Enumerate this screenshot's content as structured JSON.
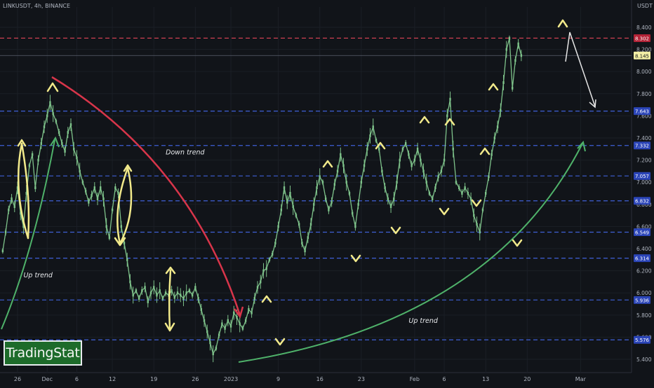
{
  "header": {
    "symbol": "LINKUSDT, 4h, BINANCE",
    "currency": "USDT"
  },
  "watermark": {
    "text": "TradingStat"
  },
  "colors": {
    "background": "#111419",
    "candle": "#7ec28a",
    "level_line": "#3f5fd6",
    "resistance_line": "#e04457",
    "down_trend": "#d8354a",
    "up_trend": "#4fb26a",
    "markers": "#f2ea8b",
    "projection": "#e6e6e6"
  },
  "chart_data": {
    "type": "line",
    "title": "",
    "xlabel": "",
    "ylabel": "",
    "ylim": [
      5.28,
      8.52
    ],
    "y_ticks": [
      5.4,
      5.6,
      5.8,
      6.0,
      6.2,
      6.4,
      6.6,
      6.8,
      7.0,
      7.2,
      7.4,
      7.6,
      7.8,
      8.0,
      8.2,
      8.4
    ],
    "y_tick_labels": [
      "5.400",
      "5.600",
      "5.800",
      "6.000",
      "6.200",
      "6.400",
      "6.600",
      "6.800",
      "7.000",
      "7.200",
      "7.400",
      "7.600",
      "7.800",
      "8.000",
      "8.200",
      "8.400"
    ],
    "x_range": [
      -5,
      96
    ],
    "x_ticks": [
      {
        "day": -5,
        "label": "26"
      },
      {
        "day": 0,
        "label": "Dec"
      },
      {
        "day": 5,
        "label": "6"
      },
      {
        "day": 11,
        "label": "12"
      },
      {
        "day": 18,
        "label": "19"
      },
      {
        "day": 25,
        "label": "26"
      },
      {
        "day": 31,
        "label": "2023"
      },
      {
        "day": 39,
        "label": "9"
      },
      {
        "day": 46,
        "label": "16"
      },
      {
        "day": 53,
        "label": "23"
      },
      {
        "day": 62,
        "label": "Feb"
      },
      {
        "day": 67,
        "label": "6"
      },
      {
        "day": 74,
        "label": "13"
      },
      {
        "day": 81,
        "label": "20"
      },
      {
        "day": 90,
        "label": "Mar"
      }
    ],
    "horizontal_levels": [
      {
        "value": 8.302,
        "label": "8.302",
        "style": "red"
      },
      {
        "value": 7.643,
        "label": "7.643",
        "style": "blue"
      },
      {
        "value": 7.332,
        "label": "7.332",
        "style": "blue"
      },
      {
        "value": 7.057,
        "label": "7.057",
        "style": "blue"
      },
      {
        "value": 6.832,
        "label": "6.832",
        "style": "blue"
      },
      {
        "value": 6.549,
        "label": "6.549",
        "style": "blue"
      },
      {
        "value": 6.314,
        "label": "6.314",
        "style": "blue"
      },
      {
        "value": 5.936,
        "label": "5.936",
        "style": "blue"
      },
      {
        "value": 5.576,
        "label": "5.576",
        "style": "blue"
      }
    ],
    "current_price": {
      "value": 8.145,
      "label": "8.145"
    },
    "series": [
      {
        "points": [
          [
            -7.5,
            6.38
          ],
          [
            -7,
            6.55
          ],
          [
            -6.5,
            6.75
          ],
          [
            -6,
            6.85
          ],
          [
            -5.5,
            6.78
          ],
          [
            -5,
            6.95
          ],
          [
            -4.5,
            6.72
          ],
          [
            -4,
            6.6
          ],
          [
            -3.5,
            6.9
          ],
          [
            -3,
            7.15
          ],
          [
            -2.5,
            7.25
          ],
          [
            -2,
            6.95
          ],
          [
            -1.5,
            7.2
          ],
          [
            -1,
            7.35
          ],
          [
            -0.5,
            7.5
          ],
          [
            0,
            7.6
          ],
          [
            0.5,
            7.72
          ],
          [
            1,
            7.62
          ],
          [
            1.5,
            7.55
          ],
          [
            2,
            7.45
          ],
          [
            2.5,
            7.35
          ],
          [
            3,
            7.28
          ],
          [
            3.5,
            7.45
          ],
          [
            4,
            7.52
          ],
          [
            4.5,
            7.3
          ],
          [
            5,
            7.22
          ],
          [
            5.5,
            7.1
          ],
          [
            6,
            7.0
          ],
          [
            6.5,
            6.92
          ],
          [
            7,
            6.82
          ],
          [
            7.5,
            6.88
          ],
          [
            8,
            6.95
          ],
          [
            8.5,
            6.85
          ],
          [
            9,
            6.95
          ],
          [
            9.5,
            6.85
          ],
          [
            10,
            6.6
          ],
          [
            10.5,
            6.5
          ],
          [
            11,
            6.75
          ],
          [
            11.5,
            6.95
          ],
          [
            12,
            6.9
          ],
          [
            12.5,
            6.6
          ],
          [
            13,
            6.45
          ],
          [
            13.5,
            6.3
          ],
          [
            14,
            6.1
          ],
          [
            14.5,
            5.98
          ],
          [
            15,
            6.02
          ],
          [
            15.5,
            5.95
          ],
          [
            16,
            6.02
          ],
          [
            16.5,
            6.05
          ],
          [
            17,
            5.92
          ],
          [
            17.5,
            6.0
          ],
          [
            18,
            6.05
          ],
          [
            18.5,
            5.98
          ],
          [
            19,
            6.02
          ],
          [
            19.5,
            5.95
          ],
          [
            20,
            6.0
          ],
          [
            20.5,
            5.98
          ],
          [
            21,
            6.02
          ],
          [
            21.5,
            5.96
          ],
          [
            22,
            6.0
          ],
          [
            22.5,
            5.98
          ],
          [
            23,
            5.95
          ],
          [
            23.5,
            6.0
          ],
          [
            24,
            6.02
          ],
          [
            24.5,
            5.98
          ],
          [
            25,
            6.05
          ],
          [
            25.5,
            5.95
          ],
          [
            26,
            5.85
          ],
          [
            26.5,
            5.75
          ],
          [
            27,
            5.65
          ],
          [
            27.5,
            5.55
          ],
          [
            28,
            5.45
          ],
          [
            28.5,
            5.5
          ],
          [
            29,
            5.62
          ],
          [
            29.5,
            5.72
          ],
          [
            30,
            5.68
          ],
          [
            30.5,
            5.75
          ],
          [
            31,
            5.7
          ],
          [
            31.5,
            5.82
          ],
          [
            32,
            5.78
          ],
          [
            32.5,
            5.72
          ],
          [
            33,
            5.68
          ],
          [
            33.5,
            5.75
          ],
          [
            34,
            5.85
          ],
          [
            34.5,
            5.82
          ],
          [
            35,
            5.95
          ],
          [
            35.5,
            6.05
          ],
          [
            36,
            6.1
          ],
          [
            36.5,
            6.2
          ],
          [
            37,
            6.22
          ],
          [
            37.5,
            6.3
          ],
          [
            38,
            6.35
          ],
          [
            38.5,
            6.45
          ],
          [
            39,
            6.6
          ],
          [
            39.5,
            6.75
          ],
          [
            40,
            6.95
          ],
          [
            40.5,
            6.82
          ],
          [
            41,
            6.9
          ],
          [
            41.5,
            6.78
          ],
          [
            42,
            6.7
          ],
          [
            42.5,
            6.62
          ],
          [
            43,
            6.45
          ],
          [
            43.5,
            6.38
          ],
          [
            44,
            6.5
          ],
          [
            44.5,
            6.62
          ],
          [
            45,
            6.8
          ],
          [
            45.5,
            6.95
          ],
          [
            46,
            7.05
          ],
          [
            46.5,
            7.0
          ],
          [
            47,
            6.85
          ],
          [
            47.5,
            6.75
          ],
          [
            48,
            6.82
          ],
          [
            48.5,
            6.98
          ],
          [
            49,
            7.1
          ],
          [
            49.5,
            7.25
          ],
          [
            50,
            7.15
          ],
          [
            50.5,
            7.0
          ],
          [
            51,
            6.9
          ],
          [
            51.5,
            6.72
          ],
          [
            52,
            6.6
          ],
          [
            52.5,
            6.8
          ],
          [
            53,
            7.0
          ],
          [
            53.5,
            7.15
          ],
          [
            54,
            7.3
          ],
          [
            54.5,
            7.42
          ],
          [
            55,
            7.5
          ],
          [
            55.5,
            7.38
          ],
          [
            56,
            7.3
          ],
          [
            56.5,
            7.1
          ],
          [
            57,
            6.95
          ],
          [
            57.5,
            6.85
          ],
          [
            58,
            6.78
          ],
          [
            58.5,
            6.85
          ],
          [
            59,
            7.0
          ],
          [
            59.5,
            7.2
          ],
          [
            60,
            7.3
          ],
          [
            60.5,
            7.35
          ],
          [
            61,
            7.25
          ],
          [
            61.5,
            7.15
          ],
          [
            62,
            7.2
          ],
          [
            62.5,
            7.3
          ],
          [
            63,
            7.2
          ],
          [
            63.5,
            7.1
          ],
          [
            64,
            7.0
          ],
          [
            64.5,
            6.9
          ],
          [
            65,
            6.85
          ],
          [
            65.5,
            6.95
          ],
          [
            66,
            7.05
          ],
          [
            66.5,
            7.1
          ],
          [
            67,
            7.2
          ],
          [
            67.5,
            7.6
          ],
          [
            68,
            7.75
          ],
          [
            68.5,
            7.3
          ],
          [
            69,
            7.0
          ],
          [
            69.5,
            6.95
          ],
          [
            70,
            6.9
          ],
          [
            70.5,
            6.95
          ],
          [
            71,
            6.9
          ],
          [
            71.5,
            6.85
          ],
          [
            72,
            6.7
          ],
          [
            72.5,
            6.62
          ],
          [
            73,
            6.55
          ],
          [
            73.5,
            6.75
          ],
          [
            74,
            6.9
          ],
          [
            74.5,
            7.05
          ],
          [
            75,
            7.25
          ],
          [
            75.5,
            7.4
          ],
          [
            76,
            7.5
          ],
          [
            76.5,
            7.65
          ],
          [
            77,
            7.9
          ],
          [
            77.5,
            8.2
          ],
          [
            78,
            8.3
          ],
          [
            78.5,
            7.85
          ],
          [
            79,
            8.1
          ],
          [
            79.5,
            8.25
          ],
          [
            80,
            8.145
          ]
        ]
      }
    ],
    "annotations": [
      {
        "text": "Down trend",
        "x": 20,
        "y": 7.25
      },
      {
        "text": "Up trend",
        "x": -4,
        "y": 6.14
      },
      {
        "text": "Up trend",
        "x": 61,
        "y": 5.73
      }
    ]
  }
}
